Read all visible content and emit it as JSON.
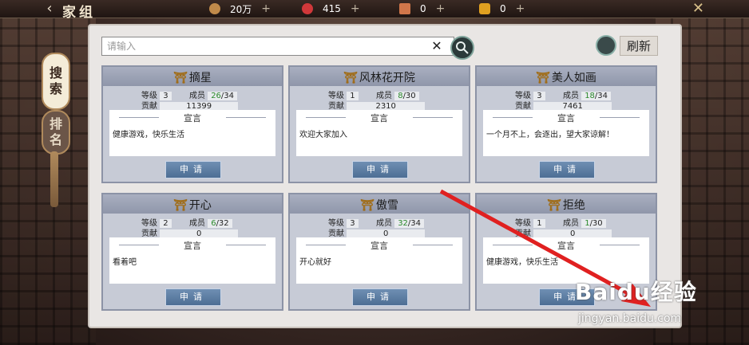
{
  "header": {
    "title": "家组",
    "resources": [
      {
        "name": "coin-icon",
        "color": "#c08a4a",
        "value": "20万"
      },
      {
        "name": "gem-icon",
        "color": "#d0383a",
        "value": "415"
      },
      {
        "name": "ticket-icon",
        "color": "#d0764a",
        "value": "0"
      },
      {
        "name": "token-icon",
        "color": "#e0a020",
        "value": "0"
      }
    ],
    "plus": "+"
  },
  "tabs": [
    {
      "label_1": "搜",
      "label_2": "索",
      "active": true
    },
    {
      "label_1": "排",
      "label_2": "名",
      "active": false
    }
  ],
  "search": {
    "placeholder": "请输入",
    "clear": "✕",
    "refresh_label": "刷新"
  },
  "cards": [
    {
      "name": "摘星",
      "level_label": "等级",
      "level": "3",
      "members_label": "成员",
      "members_cur": "26",
      "members_max": "/34",
      "contrib_label": "贡献",
      "contrib": "11399",
      "decl_label": "宣言",
      "decl": "健康游戏，快乐生活",
      "apply": "申请"
    },
    {
      "name": "风林花开院",
      "level_label": "等级",
      "level": "1",
      "members_label": "成员",
      "members_cur": "8",
      "members_max": "/30",
      "contrib_label": "贡献",
      "contrib": "2310",
      "decl_label": "宣言",
      "decl": "欢迎大家加入",
      "apply": "申请"
    },
    {
      "name": "美人如画",
      "level_label": "等级",
      "level": "3",
      "members_label": "成员",
      "members_cur": "18",
      "members_max": "/34",
      "contrib_label": "贡献",
      "contrib": "7461",
      "decl_label": "宣言",
      "decl": "一个月不上，会逐出，望大家谅解！",
      "apply": "申请"
    },
    {
      "name": "开心",
      "level_label": "等级",
      "level": "2",
      "members_label": "成员",
      "members_cur": "6",
      "members_max": "/32",
      "contrib_label": "贡献",
      "contrib": "0",
      "decl_label": "宣言",
      "decl": "看着吧",
      "apply": "申请"
    },
    {
      "name": "傲雪",
      "level_label": "等级",
      "level": "3",
      "members_label": "成员",
      "members_cur": "32",
      "members_max": "/34",
      "contrib_label": "贡献",
      "contrib": "0",
      "decl_label": "宣言",
      "decl": "开心就好",
      "apply": "申请"
    },
    {
      "name": "拒绝",
      "level_label": "等级",
      "level": "1",
      "members_label": "成员",
      "members_cur": "1",
      "members_max": "/30",
      "contrib_label": "贡献",
      "contrib": "0",
      "decl_label": "宣言",
      "decl": "健康游戏，快乐生活",
      "apply": "申请"
    }
  ],
  "watermark": {
    "brand": "Baidu经验",
    "url": "jingyan.baidu.com"
  }
}
